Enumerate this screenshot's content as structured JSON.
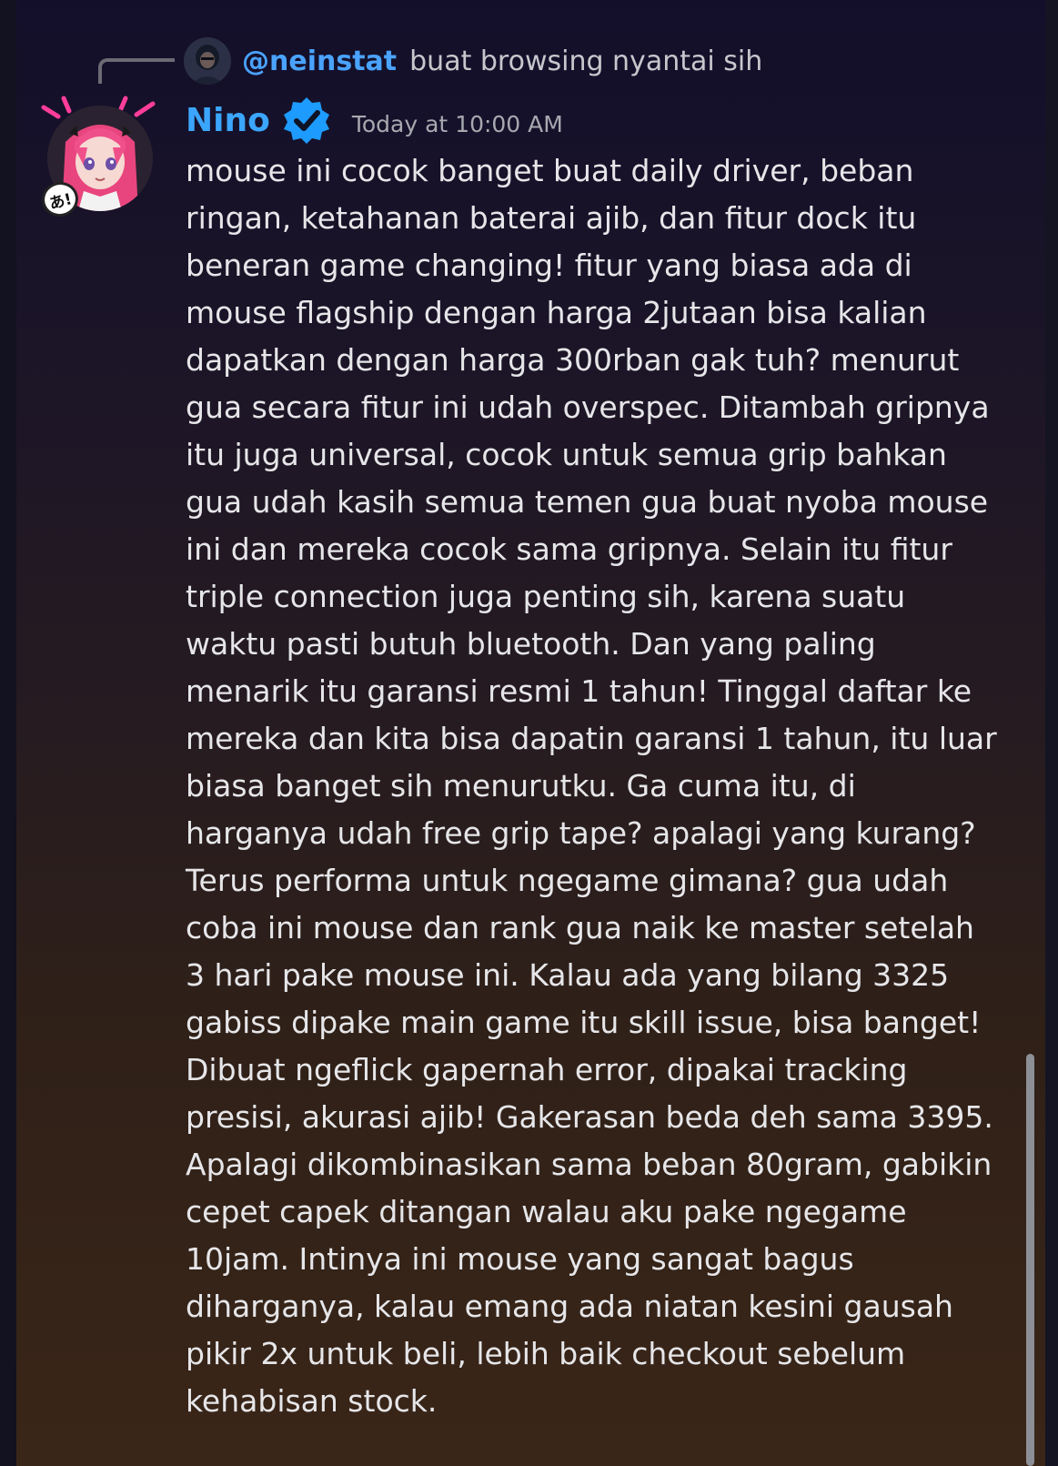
{
  "reply": {
    "username": "@neinstat",
    "text": "buat browsing nyantai sih"
  },
  "message": {
    "author": "Nino",
    "timestamp": "Today at 10:00 AM",
    "avatar_badge": "あ!",
    "body": "mouse ini cocok banget buat daily driver, beban\nringan, ketahanan baterai ajib, dan fitur dock itu\nbeneran game changing! fitur yang biasa ada di\nmouse flagship dengan harga 2jutaan bisa kalian\ndapatkan dengan harga 300rban gak tuh? menurut\ngua secara fitur ini udah overspec. Ditambah gripnya\nitu juga universal, cocok untuk semua grip bahkan\ngua udah kasih semua temen gua buat nyoba mouse\nini dan mereka cocok sama gripnya. Selain itu fitur\ntriple connection juga penting sih, karena suatu\nwaktu pasti butuh bluetooth. Dan yang paling\nmenarik itu garansi resmi 1 tahun! Tinggal daftar ke\nmereka dan kita bisa dapatin garansi 1 tahun, itu luar\nbiasa banget sih menurutku. Ga cuma itu, di\nharganya udah free grip tape? apalagi yang kurang?\nTerus performa untuk ngegame gimana? gua udah\ncoba ini mouse dan rank gua naik ke master setelah\n3 hari pake mouse ini. Kalau ada yang bilang 3325\ngabiss dipake main game itu skill issue, bisa banget!\nDibuat ngeflick gapernah error, dipakai tracking\npresisi, akurasi ajib! Gakerasan beda deh sama 3395.\nApalagi dikombinasikan sama beban 80gram, gabikin\ncepet capek ditangan walau aku pake ngegame\n10jam. Intinya ini mouse yang sangat bagus\ndiharganya, kalau emang ada niatan kesini gausah\npikir 2x untuk beli, lebih baik checkout sebelum\nkehabisan stock."
  },
  "icons": {
    "verified": "verified-badge-icon",
    "reply_avatar": "user-avatar",
    "author_avatar": "anime-avatar"
  },
  "colors": {
    "username": "#3ba6ff",
    "mention": "#4aa3ff",
    "timestamp": "#a7a9b0",
    "body_text": "#e6e6e9",
    "verified_badge": "#1e9bff",
    "avatar_deco": "#ff3d9a"
  }
}
